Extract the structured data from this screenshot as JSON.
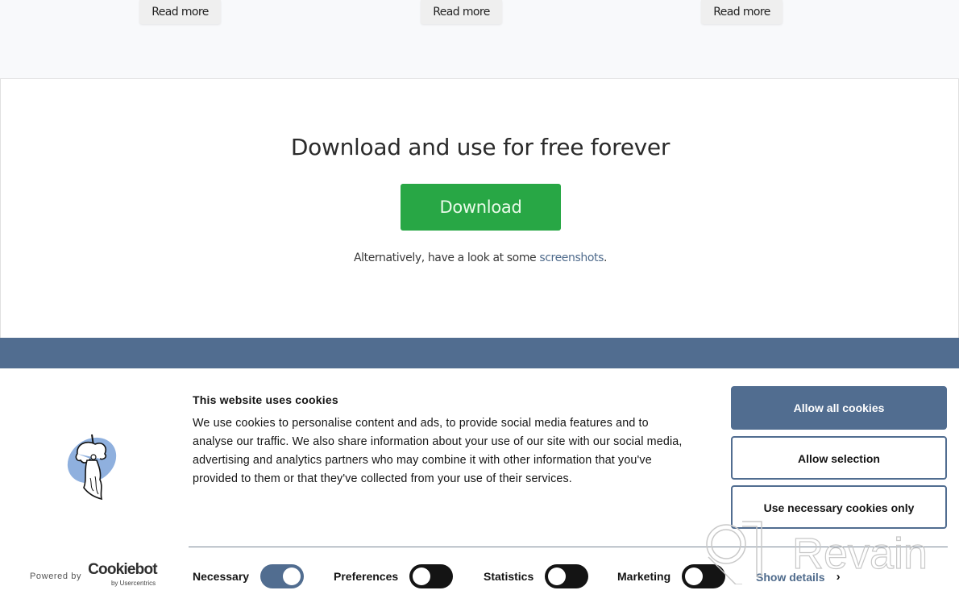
{
  "read_more": {
    "items": [
      {
        "label": "Read more"
      },
      {
        "label": "Read more"
      },
      {
        "label": "Read more"
      }
    ]
  },
  "download_section": {
    "title": "Download and use for free forever",
    "button_label": "Download",
    "alt_prefix": "Alternatively, have a look at some ",
    "alt_link": "screenshots",
    "alt_suffix": "."
  },
  "cookie_banner": {
    "logo_icon": "bearded-man-logo",
    "title": "This website uses cookies",
    "text": "We use cookies to personalise content and ads, to provide social media features and to analyse our traffic. We also share information about your use of our site with our social media, advertising and analytics partners who may combine it with other information that you've provided to them or that they've collected from your use of their services.",
    "buttons": {
      "allow_all": "Allow all cookies",
      "allow_selection": "Allow selection",
      "necessary_only": "Use necessary cookies only"
    },
    "powered_by": "Powered by",
    "brand_name": "Cookiebot",
    "brand_sub": "by Usercentrics",
    "toggles": [
      {
        "label": "Necessary",
        "state": "on"
      },
      {
        "label": "Preferences",
        "state": "off"
      },
      {
        "label": "Statistics",
        "state": "off"
      },
      {
        "label": "Marketing",
        "state": "off"
      }
    ],
    "show_details": "Show details",
    "show_details_icon": "chevron-right-icon"
  },
  "watermark": {
    "text": "Revain"
  },
  "colors": {
    "accent_blue": "#516d90",
    "download_green": "#28a745",
    "link_blue": "#4f6b8c",
    "toggle_off": "#141414"
  }
}
